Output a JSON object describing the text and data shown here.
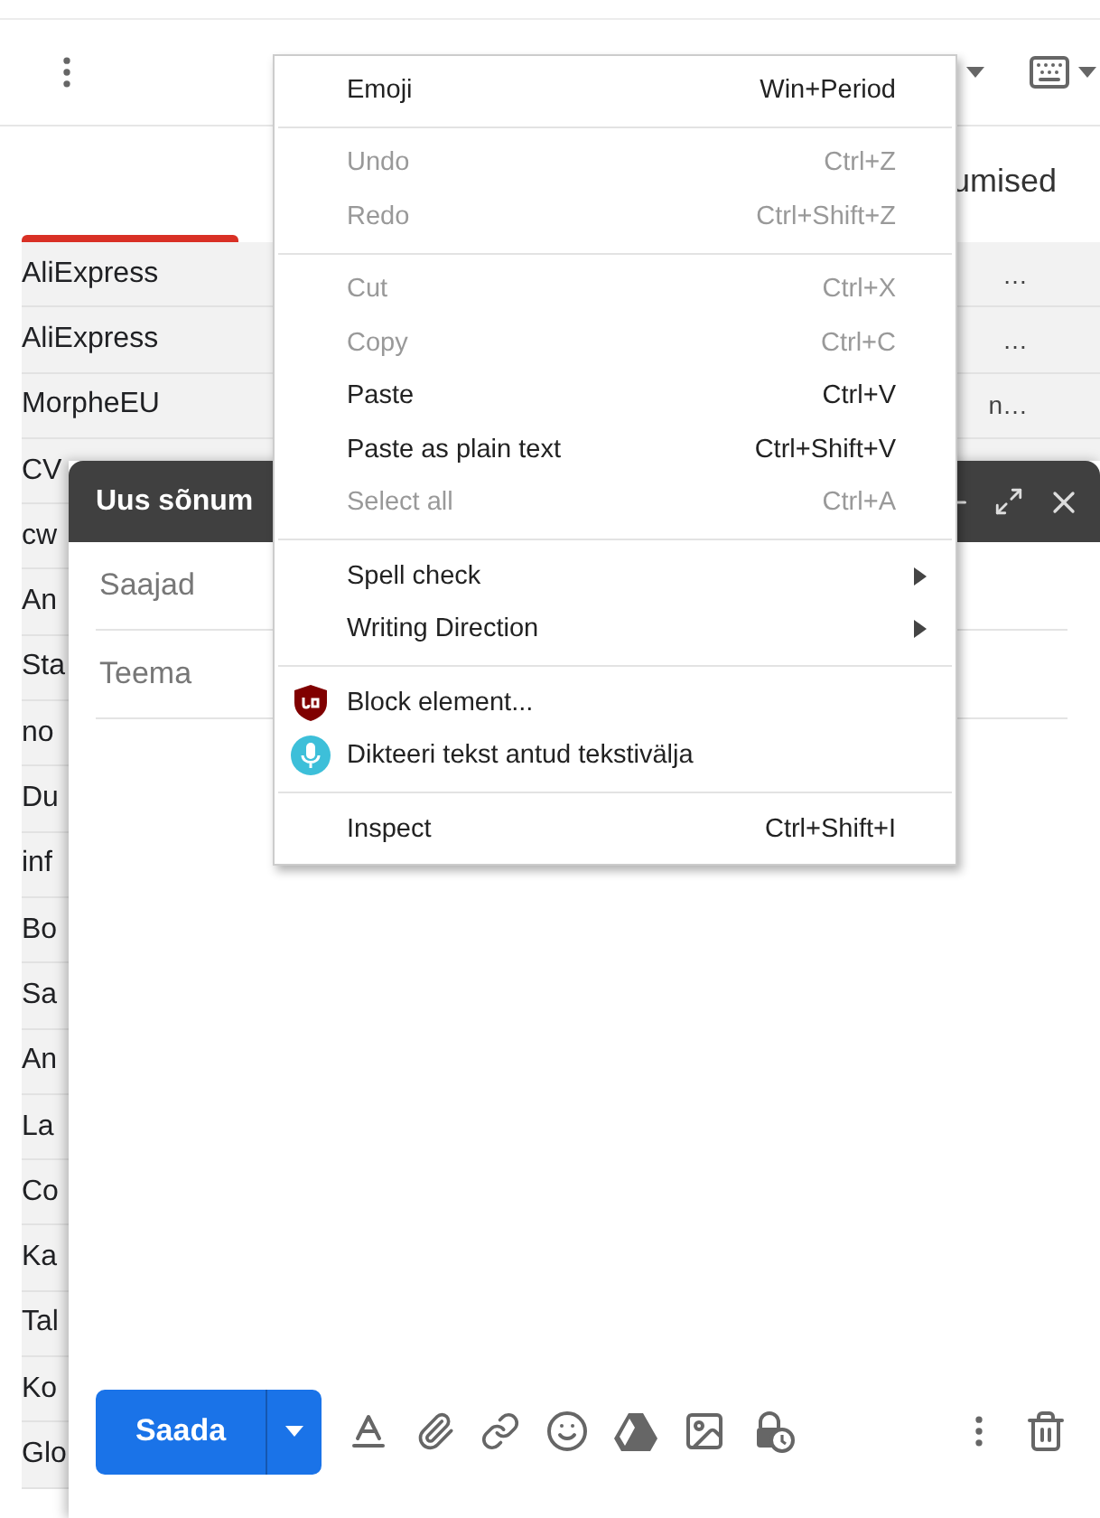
{
  "mail_list": {
    "column_header": "umised",
    "rows": [
      {
        "sender": "AliExpress",
        "snippet": "…"
      },
      {
        "sender": "AliExpress",
        "snippet": "…"
      },
      {
        "sender": "MorpheEU",
        "snippet": "n…"
      },
      {
        "sender": "CV"
      },
      {
        "sender": "cw"
      },
      {
        "sender": "An"
      },
      {
        "sender": "Sta"
      },
      {
        "sender": "no"
      },
      {
        "sender": "Du"
      },
      {
        "sender": "inf"
      },
      {
        "sender": "Bo"
      },
      {
        "sender": "Sa"
      },
      {
        "sender": "An"
      },
      {
        "sender": "La"
      },
      {
        "sender": "Co"
      },
      {
        "sender": "Ka"
      },
      {
        "sender": "Tal"
      },
      {
        "sender": "Ko"
      },
      {
        "sender": "Glo"
      }
    ]
  },
  "compose": {
    "title": "Uus sõnum",
    "recipients": {
      "placeholder": "Saajad"
    },
    "subject": {
      "placeholder": "Teema"
    },
    "send_button": "Saada"
  },
  "context_menu": {
    "sections": [
      [
        {
          "kind": "plain",
          "label": "Emoji",
          "shortcut": "Win+Period",
          "disabled": false
        }
      ],
      [
        {
          "kind": "plain",
          "label": "Undo",
          "shortcut": "Ctrl+Z",
          "disabled": true
        },
        {
          "kind": "plain",
          "label": "Redo",
          "shortcut": "Ctrl+Shift+Z",
          "disabled": true
        }
      ],
      [
        {
          "kind": "plain",
          "label": "Cut",
          "shortcut": "Ctrl+X",
          "disabled": true
        },
        {
          "kind": "plain",
          "label": "Copy",
          "shortcut": "Ctrl+C",
          "disabled": true
        },
        {
          "kind": "plain",
          "label": "Paste",
          "shortcut": "Ctrl+V",
          "disabled": false
        },
        {
          "kind": "plain",
          "label": "Paste as plain text",
          "shortcut": "Ctrl+Shift+V",
          "disabled": false
        },
        {
          "kind": "plain",
          "label": "Select all",
          "shortcut": "Ctrl+A",
          "disabled": true
        }
      ],
      [
        {
          "kind": "submenu",
          "label": "Spell check",
          "disabled": false
        },
        {
          "kind": "submenu",
          "label": "Writing Direction",
          "disabled": false
        }
      ],
      [
        {
          "kind": "blocker",
          "label": "Block element...",
          "disabled": false
        },
        {
          "kind": "dictation",
          "label": "Dikteeri tekst antud tekstivälja",
          "disabled": false
        }
      ],
      [
        {
          "kind": "plain",
          "label": "Inspect",
          "shortcut": "Ctrl+Shift+I",
          "disabled": false
        }
      ]
    ]
  }
}
